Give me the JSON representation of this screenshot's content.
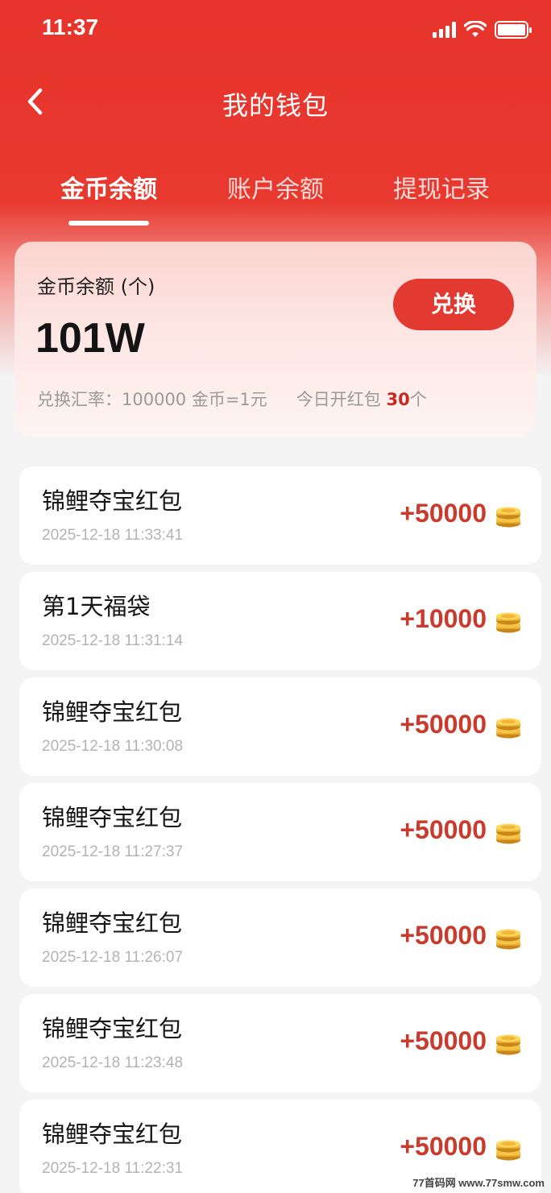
{
  "status_bar": {
    "time": "11:37"
  },
  "nav": {
    "title": "我的钱包"
  },
  "tabs": [
    {
      "label": "金币余额",
      "active": true
    },
    {
      "label": "账户余额",
      "active": false
    },
    {
      "label": "提现记录",
      "active": false
    }
  ],
  "balance": {
    "label": "金币余额 (个)",
    "value": "101W",
    "exchange_button": "兑换",
    "rate_text": "兑换汇率：100000 金币=1元",
    "today_prefix": "今日开红包",
    "today_count": "30",
    "today_suffix": "个"
  },
  "records": [
    {
      "title": "锦鲤夺宝红包",
      "time": "2025-12-18 11:33:41",
      "amount": "+50000",
      "icon": "coin-stack-icon"
    },
    {
      "title": "第1天福袋",
      "time": "2025-12-18 11:31:14",
      "amount": "+10000",
      "icon": "coin-stack-icon"
    },
    {
      "title": "锦鲤夺宝红包",
      "time": "2025-12-18 11:30:08",
      "amount": "+50000",
      "icon": "coin-stack-icon"
    },
    {
      "title": "锦鲤夺宝红包",
      "time": "2025-12-18 11:27:37",
      "amount": "+50000",
      "icon": "coin-stack-icon"
    },
    {
      "title": "锦鲤夺宝红包",
      "time": "2025-12-18 11:26:07",
      "amount": "+50000",
      "icon": "coin-stack-icon"
    },
    {
      "title": "锦鲤夺宝红包",
      "time": "2025-12-18 11:23:48",
      "amount": "+50000",
      "icon": "coin-stack-icon"
    },
    {
      "title": "锦鲤夺宝红包",
      "time": "2025-12-18 11:22:31",
      "amount": "+50000",
      "icon": "coin-stack-icon"
    }
  ],
  "watermark": "77首码网 www.77smw.com",
  "colors": {
    "primary_red": "#e7342c",
    "amount_red": "#c93b2c",
    "button_red": "#e23a30"
  }
}
